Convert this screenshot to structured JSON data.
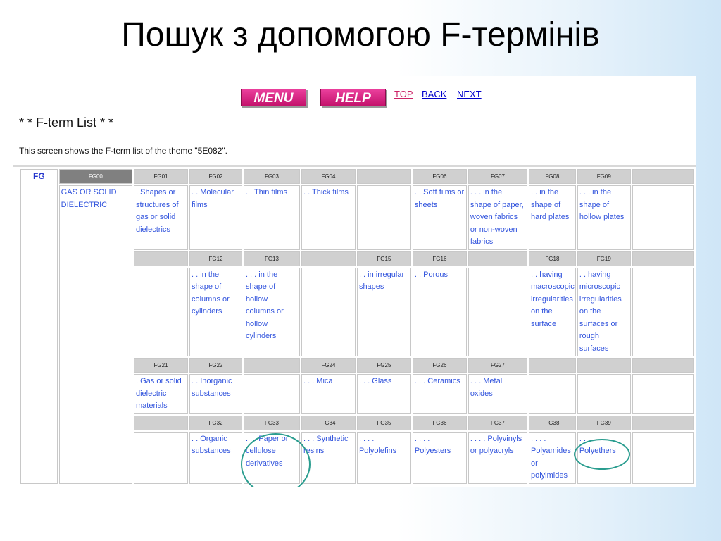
{
  "slide": {
    "title": "Пошук з допомогою F-термінів"
  },
  "nav": {
    "menu_label": "MENU",
    "help_label": "HELP",
    "top_label": "TOP",
    "back_label": "BACK",
    "next_label": "NEXT"
  },
  "page": {
    "list_title": "* * F-term List * *",
    "description": "This screen shows the F-term list of the theme \"5E082\"."
  },
  "colors": {
    "button": "#d91a7c",
    "link": "#0000cc",
    "circle": "#2a9d8f",
    "header_cell": "#d0d0d0"
  },
  "table": {
    "group": "FG",
    "first_code": "FG00",
    "first_desc": "GAS OR SOLID DIELECTRIC",
    "blocks": [
      {
        "codes": [
          "FG01",
          "FG02",
          "FG03",
          "FG04",
          "",
          "FG06",
          "FG07",
          "FG08",
          "FG09",
          ""
        ],
        "descs": [
          ". Shapes or structures of gas or solid dielectrics",
          ". . Molecular films",
          ". . Thin films",
          ". . Thick films",
          "",
          ". . Soft films or sheets",
          ". . . in the shape of paper, woven fabrics or non-woven fabrics",
          ". . in the shape of hard plates",
          ". . . in the shape of hollow plates",
          ""
        ]
      },
      {
        "codes": [
          "",
          "FG12",
          "FG13",
          "",
          "FG15",
          "FG16",
          "",
          "FG18",
          "FG19",
          ""
        ],
        "descs": [
          "",
          ". . in the shape of columns or cylinders",
          ". . . in the shape of hollow columns or hollow cylinders",
          "",
          ". . in irregular shapes",
          ". . Porous",
          "",
          ". . having macroscopic irregularities on the surface",
          ". . having microscopic irregularities on the surfaces or rough surfaces",
          ""
        ]
      },
      {
        "codes": [
          "FG21",
          "FG22",
          "",
          "FG24",
          "FG25",
          "FG26",
          "FG27",
          "",
          "",
          ""
        ],
        "descs": [
          ". Gas or solid dielectric materials",
          ". . Inorganic substances",
          "",
          ". . . Mica",
          ". . . Glass",
          ". . . Ceramics",
          ". . . Metal oxides",
          "",
          "",
          ""
        ]
      },
      {
        "codes": [
          "",
          "FG32",
          "FG33",
          "FG34",
          "FG35",
          "FG36",
          "FG37",
          "FG38",
          "FG39",
          ""
        ],
        "descs": [
          "",
          ". . Organic substances",
          ". . . Paper or cellulose derivatives",
          ". . . Synthetic resins",
          ". . . . Polyolefins",
          ". . . . Polyesters",
          ". . . . Polyvinyls or polyacryls",
          ". . . . Polyamides or polyimides",
          ". . . . Polyethers",
          ""
        ]
      }
    ]
  }
}
